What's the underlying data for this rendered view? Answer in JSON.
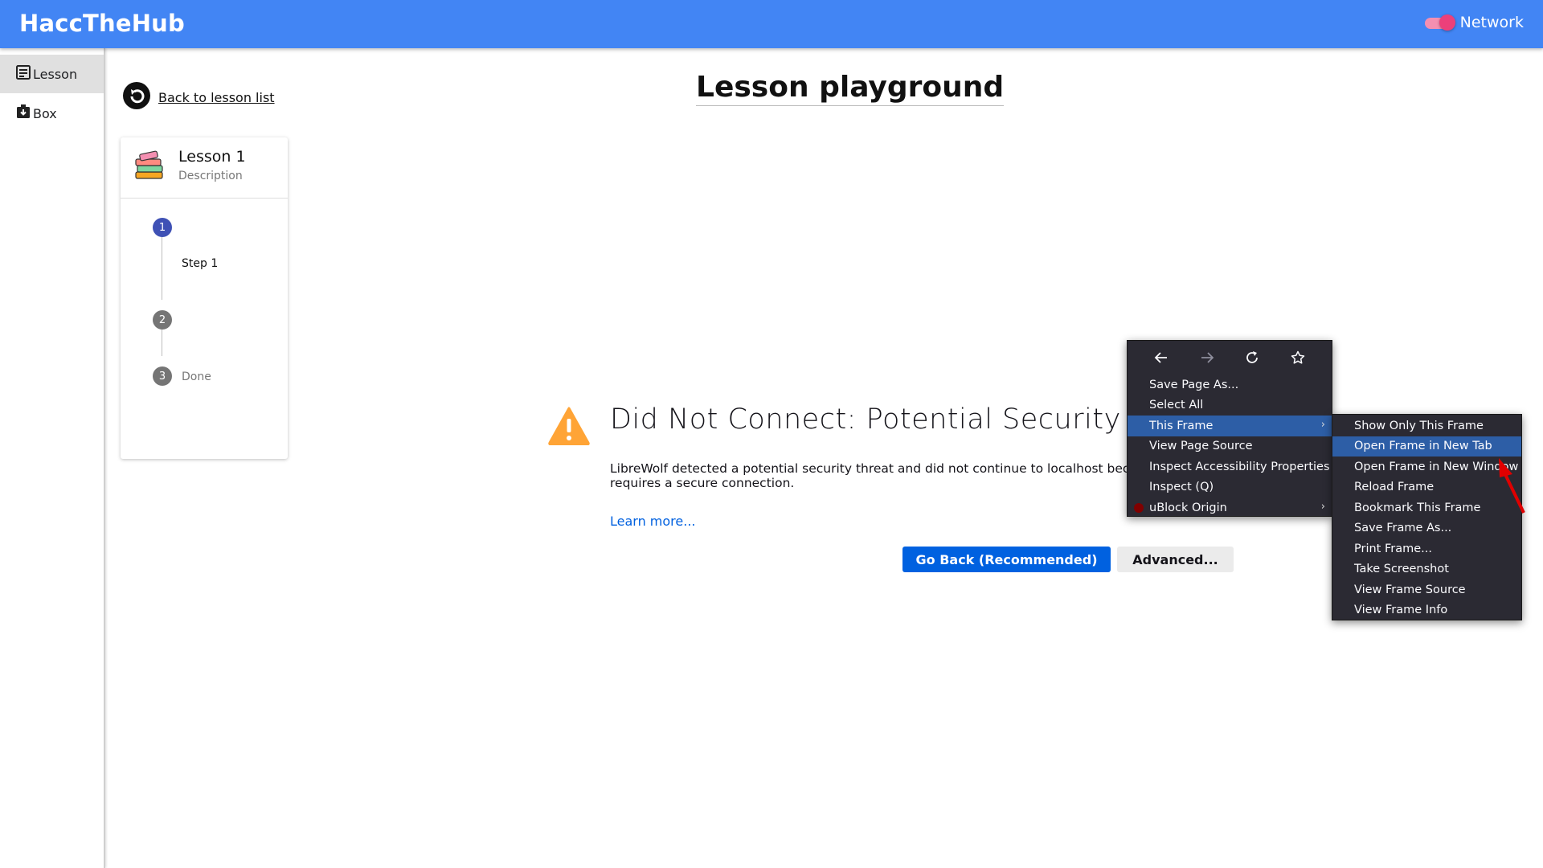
{
  "app": {
    "title": "HaccTheHub",
    "network_label": "Network",
    "network_on": true
  },
  "sidebar": {
    "items": [
      {
        "label": "Lesson",
        "icon": "lesson-icon",
        "active": true
      },
      {
        "label": "Box",
        "icon": "box-icon",
        "active": false
      }
    ]
  },
  "back_link": "Back to lesson list",
  "page_title": "Lesson playground",
  "lesson": {
    "title": "Lesson 1",
    "description": "Description",
    "steps": [
      {
        "number": "1",
        "label": "Step 1",
        "active": true
      },
      {
        "number": "2",
        "label": "",
        "active": false
      },
      {
        "number": "3",
        "label": "Done",
        "active": false
      }
    ]
  },
  "error_page": {
    "title": "Did Not Connect: Potential Security Issue",
    "body_line1": "LibreWolf detected a potential security threat and did not continue to localhost because",
    "body_line2": "requires a secure connection.",
    "learn_more": "Learn more...",
    "go_back_button": "Go Back (Recommended)",
    "advanced_button": "Advanced..."
  },
  "context_menu": {
    "nav_icons": [
      "back-arrow-icon",
      "forward-arrow-icon",
      "reload-icon",
      "bookmark-star-icon"
    ],
    "items": [
      "Save Page As...",
      "Select All",
      "This Frame",
      "View Page Source",
      "Inspect Accessibility Properties",
      "Inspect (Q)",
      "uBlock Origin"
    ],
    "highlighted": "This Frame"
  },
  "submenu": {
    "items": [
      "Show Only This Frame",
      "Open Frame in New Tab",
      "Open Frame in New Window",
      "Reload Frame",
      "Bookmark This Frame",
      "Save Frame As...",
      "Print Frame...",
      "Take Screenshot",
      "View Frame Source",
      "View Frame Info"
    ],
    "highlighted": "Open Frame in New Tab"
  },
  "colors": {
    "appbar": "#4285f4",
    "toggle": "#ec407a",
    "step_active": "#3f51b5",
    "step_inactive": "#757575",
    "primary_button": "#0061e0",
    "warning": "#ffa436",
    "menu_bg": "#2b2a33",
    "menu_highlight": "#2d5ea6",
    "annotation_arrow": "#e00000"
  }
}
